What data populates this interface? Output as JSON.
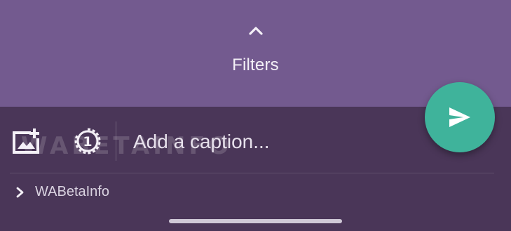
{
  "filters": {
    "label": "Filters",
    "chevron_icon": "chevron-up-icon"
  },
  "caption": {
    "placeholder": "Add a caption...",
    "value": ""
  },
  "toolbar": {
    "add_media_icon": "add-image-icon",
    "view_once_icon": "view-once-icon",
    "view_once_digit": "1"
  },
  "send": {
    "icon": "send-icon",
    "color": "#3fb39b"
  },
  "recipient": {
    "chevron_icon": "chevron-right-icon",
    "name": "WABetaInfo"
  },
  "watermark": {
    "text": "WABETAINFO"
  },
  "colors": {
    "filters_background": "#735a8f",
    "panel_background": "#4a3658",
    "text": "#f4f0f7"
  }
}
